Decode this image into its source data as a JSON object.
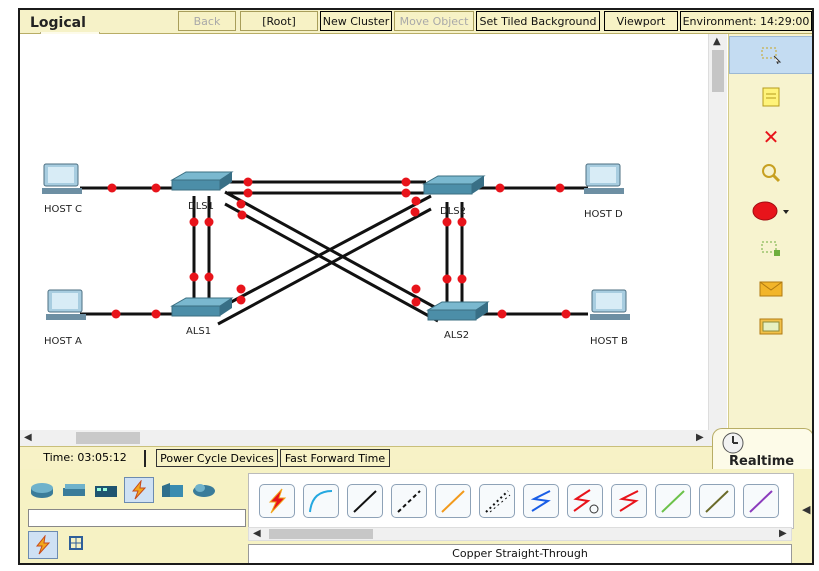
{
  "workspace": {
    "tab_label": "Logical",
    "toolbar": {
      "back": "Back",
      "root": "[Root]",
      "new_cluster": "New Cluster",
      "move_object": "Move Object",
      "set_tiled_background": "Set Tiled Background",
      "viewport": "Viewport",
      "environment": "Environment: 14:29:00"
    }
  },
  "topology": {
    "devices": [
      {
        "id": "host-c",
        "label": "HOST C",
        "type": "pc"
      },
      {
        "id": "dls1",
        "label": "DLS1",
        "type": "switch"
      },
      {
        "id": "dls2",
        "label": "DLS2",
        "type": "switch"
      },
      {
        "id": "host-d",
        "label": "HOST D",
        "type": "pc"
      },
      {
        "id": "host-a",
        "label": "HOST A",
        "type": "pc"
      },
      {
        "id": "als1",
        "label": "ALS1",
        "type": "switch"
      },
      {
        "id": "als2",
        "label": "ALS2",
        "type": "switch"
      },
      {
        "id": "host-b",
        "label": "HOST B",
        "type": "pc"
      }
    ],
    "link_status_color": "#e8141b"
  },
  "right_toolbar": {
    "items": [
      {
        "name": "select-icon",
        "selected": true
      },
      {
        "name": "note-icon"
      },
      {
        "name": "delete-icon"
      },
      {
        "name": "inspect-icon"
      },
      {
        "name": "draw-shape-icon"
      },
      {
        "name": "resize-icon"
      },
      {
        "name": "add-simple-pdu-icon"
      },
      {
        "name": "add-complex-pdu-icon"
      }
    ]
  },
  "status": {
    "time": "Time: 03:05:12",
    "power_cycle": "Power Cycle Devices",
    "fast_forward": "Fast Forward Time",
    "mode": "Realtime"
  },
  "device_panel": {
    "categories": [
      "routers-icon",
      "switches-icon",
      "hubs-icon",
      "connections-icon",
      "end-devices-icon",
      "wan-emulation-icon"
    ],
    "selected_category": "connections-icon",
    "search_value": "",
    "cables": [
      {
        "name": "automatic-connection-icon",
        "color": "#e8141b"
      },
      {
        "name": "console-cable-icon",
        "color": "#25a8e0"
      },
      {
        "name": "copper-straight-through-icon",
        "color": "#111111"
      },
      {
        "name": "copper-cross-over-icon",
        "color": "#111111"
      },
      {
        "name": "fiber-icon",
        "color": "#f29a1c"
      },
      {
        "name": "phone-cable-icon",
        "color": "#111111"
      },
      {
        "name": "coaxial-cable-icon",
        "color": "#1a5ee6"
      },
      {
        "name": "serial-dce-icon",
        "color": "#e8141b"
      },
      {
        "name": "serial-dte-icon",
        "color": "#e8141b"
      },
      {
        "name": "octal-cable-icon",
        "color": "#6cc24a"
      },
      {
        "name": "iot-custom-cable-icon",
        "color": "#6b6b2a"
      },
      {
        "name": "usb-cable-icon",
        "color": "#8b3bbd"
      }
    ],
    "selected_cable_name": "Copper Straight-Through"
  }
}
